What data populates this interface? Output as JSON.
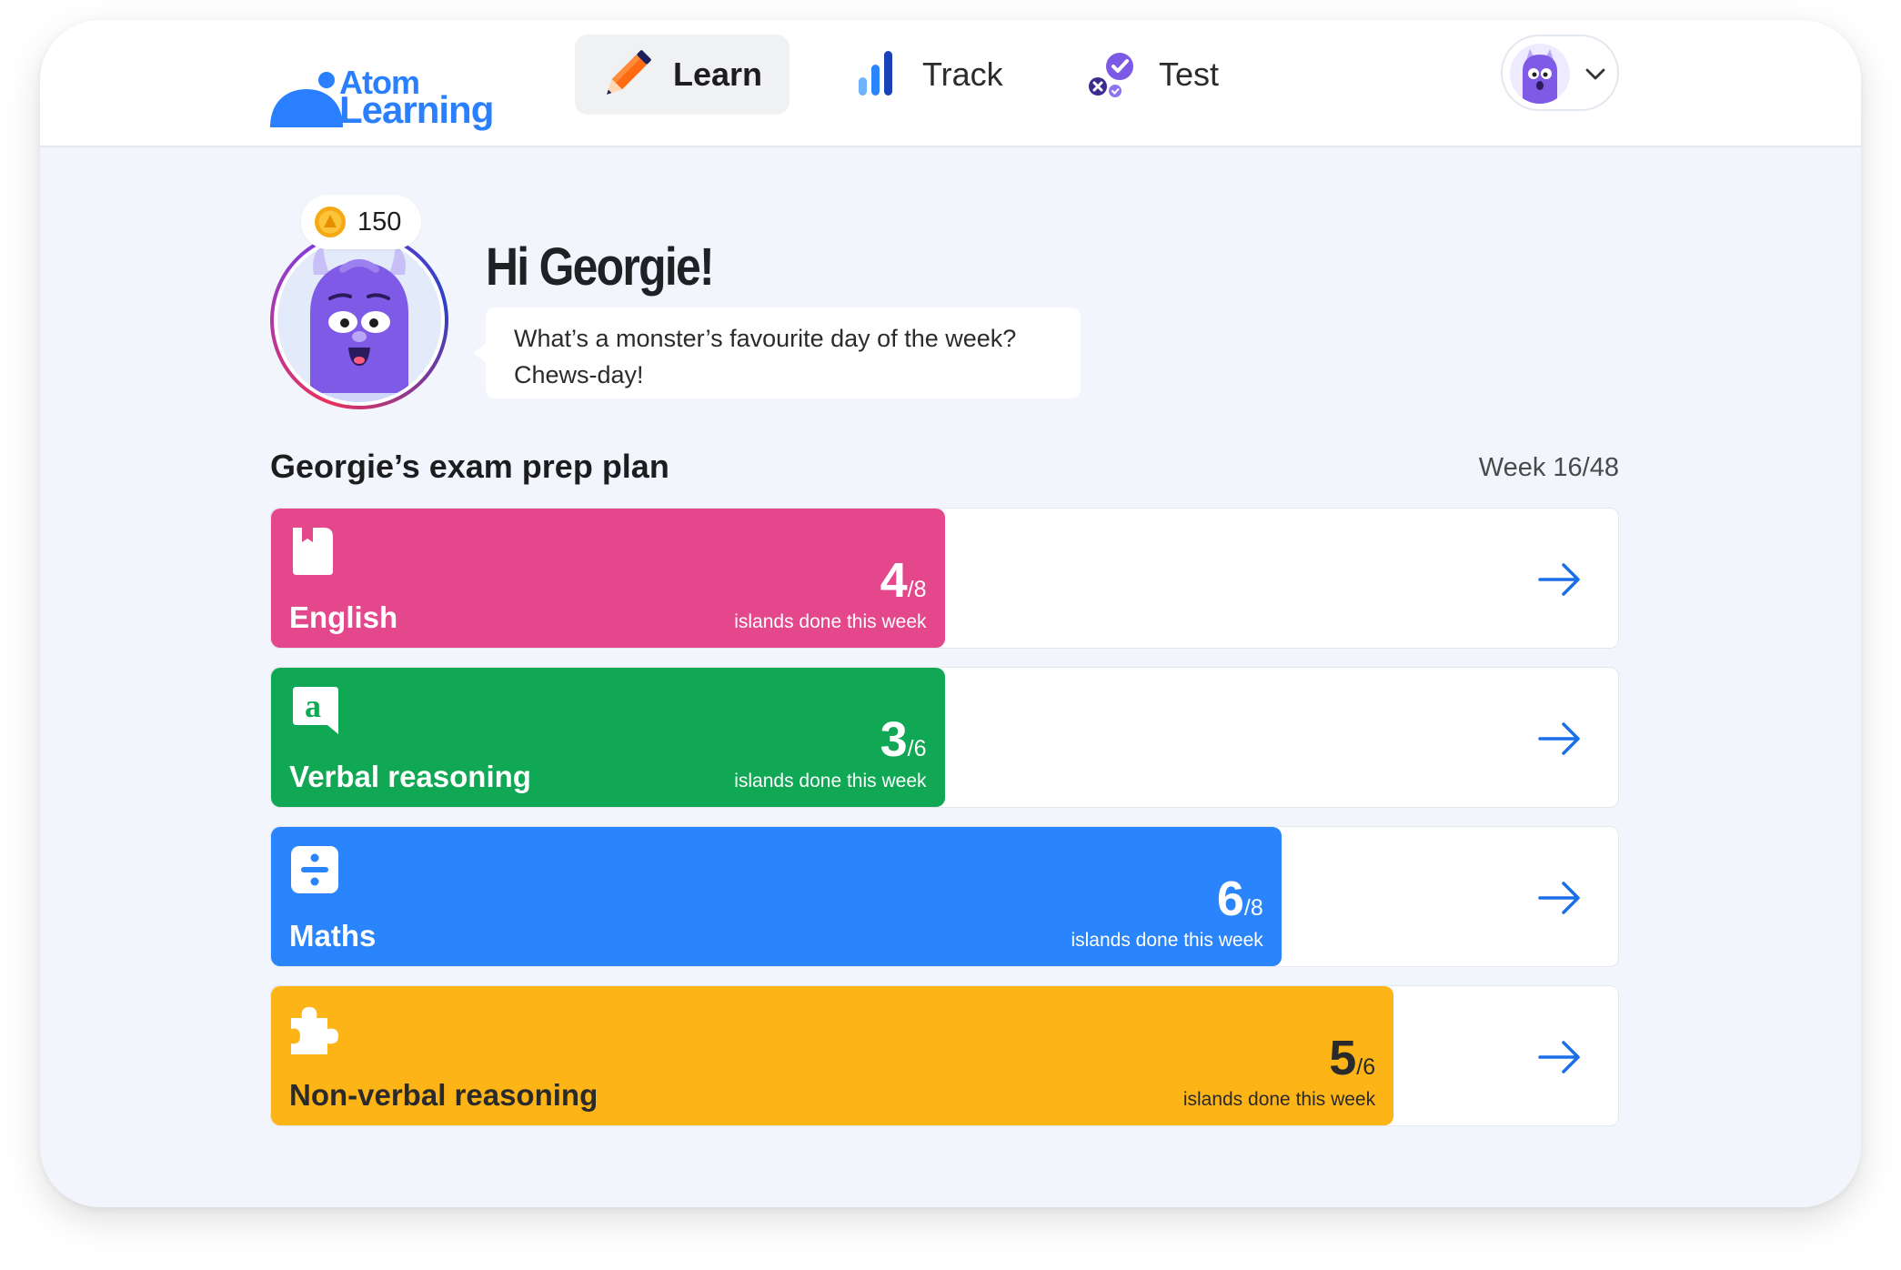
{
  "brand": {
    "line1": "Atom",
    "line2": "Learning",
    "color": "#2a7fff"
  },
  "nav": {
    "learn": {
      "label": "Learn",
      "icon": "pencil-icon",
      "active": true
    },
    "track": {
      "label": "Track",
      "icon": "bar-chart-icon"
    },
    "test": {
      "label": "Test",
      "icon": "test-check-icon"
    }
  },
  "profile": {
    "avatar": "monster-avatar",
    "menu_icon": "chevron-down-icon"
  },
  "coins": {
    "count": "150",
    "icon": "coin-icon"
  },
  "greeting": {
    "title": "Hi Georgie!",
    "joke_line1": "What’s a monster’s favourite day of the week?",
    "joke_line2": "Chews-day!"
  },
  "plan": {
    "title": "Georgie’s exam prep plan",
    "week": "Week 16/48",
    "subjects": [
      {
        "name": "English",
        "done": "4",
        "total": "/8",
        "caption": "islands done this week",
        "color": "#e4478b",
        "icon": "book-icon",
        "fraction": 0.5
      },
      {
        "name": "Verbal reasoning",
        "done": "3",
        "total": "/6",
        "caption": "islands done this week",
        "color": "#10a854",
        "icon": "letter-a-bubble-icon",
        "fraction": 0.5
      },
      {
        "name": "Maths",
        "done": "6",
        "total": "/8",
        "caption": "islands done this week",
        "color": "#2a84fb",
        "icon": "divide-icon",
        "fraction": 0.75
      },
      {
        "name": "Non-verbal reasoning",
        "done": "5",
        "total": "/6",
        "caption": "islands done this week",
        "color": "#fdb417",
        "icon": "puzzle-icon",
        "fraction": 0.8333
      }
    ]
  }
}
